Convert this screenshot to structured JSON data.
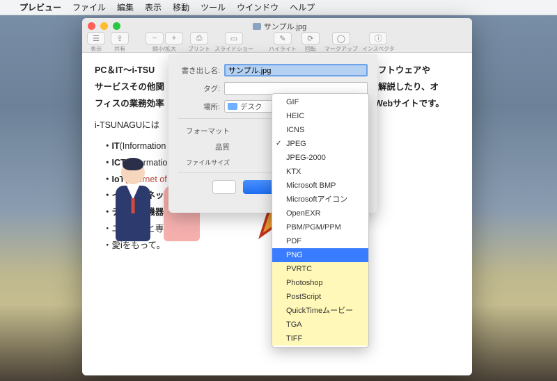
{
  "menubar": {
    "app": "プレビュー",
    "items": [
      "ファイル",
      "編集",
      "表示",
      "移動",
      "ツール",
      "ウインドウ",
      "ヘルプ"
    ]
  },
  "window": {
    "title": "サンプル.jpg",
    "toolbar": [
      {
        "label": "表示",
        "icons": [
          "☰"
        ]
      },
      {
        "label": "共有",
        "icons": [
          "⇪"
        ]
      },
      {
        "label": "縮小/拡大",
        "icons": [
          "−",
          "+"
        ]
      },
      {
        "label": "プリント",
        "icons": [
          "⎙"
        ]
      },
      {
        "label": "スライドショー",
        "icons": [
          "▭"
        ]
      },
      {
        "label": "ハイライト",
        "icons": [
          "✎"
        ]
      },
      {
        "label": "回転",
        "icons": [
          "⟳"
        ]
      },
      {
        "label": "マークアップ",
        "icons": [
          "◯"
        ]
      },
      {
        "label": "インスペクタ",
        "icons": [
          "ⓘ"
        ]
      }
    ]
  },
  "content": {
    "l1a": "PC＆IT～i-TSU",
    "l1b": "ンソフトウェアや",
    "l2a": "サービスその他関",
    "l2b": "去を解説したり、オ",
    "l3a": "フィスの業務効率",
    "l3b": "Webサイトです。",
    "l4": "i-TSUNAGUには",
    "b1a": "・IT",
    "b1b": "(Information ",
    "b2a": "・ICT",
    "b2b": "(Informatio",
    "b3a": "・IoT",
    "b3b": "(Internet of",
    "b4": "・インターネット",
    "b5": "・デジタル機器、",
    "b6": "・ユーザーと専門",
    "b7": "・愛iをもって。"
  },
  "sheet": {
    "name_label": "書き出し名:",
    "name_value": "サンプル.jpg",
    "tag_label": "タグ:",
    "tag_value": "",
    "loc_label": "場所:",
    "loc_value": "デスク",
    "format_label": "フォーマット",
    "quality_label": "品質",
    "filesize_label": "ファイルサイズ",
    "cancel": "",
    "save": ""
  },
  "dropdown": {
    "items": [
      "GIF",
      "HEIC",
      "ICNS",
      "JPEG",
      "JPEG-2000",
      "KTX",
      "Microsoft BMP",
      "Microsoftアイコン",
      "OpenEXR",
      "PBM/PGM/PPM",
      "PDF",
      "PNG",
      "PVRTC",
      "Photoshop",
      "PostScript",
      "QuickTimeムービー",
      "TGA",
      "TIFF"
    ],
    "checked": "JPEG",
    "highlighted": "PNG"
  }
}
